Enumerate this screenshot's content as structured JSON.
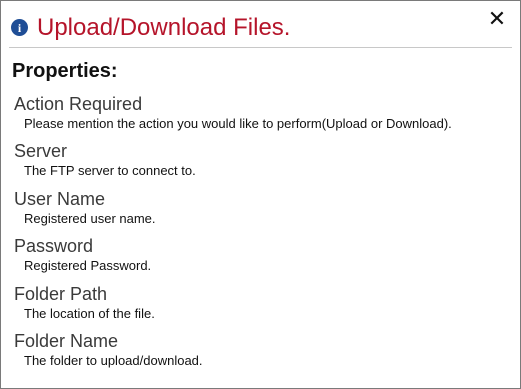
{
  "dialog": {
    "title": "Upload/Download Files.",
    "icon": "info-icon",
    "close_symbol": "✕",
    "title_color": "#b5142a",
    "icon_color": "#1f4e96"
  },
  "properties": {
    "heading": "Properties:",
    "items": [
      {
        "name": "Action Required",
        "description": "Please mention the action you would like to perform(Upload or Download)."
      },
      {
        "name": "Server",
        "description": "The FTP server to connect to."
      },
      {
        "name": "User Name",
        "description": "Registered user name."
      },
      {
        "name": "Password",
        "description": "Registered Password."
      },
      {
        "name": "Folder Path",
        "description": "The location of the file."
      },
      {
        "name": "Folder Name",
        "description": "The folder to upload/download."
      }
    ]
  }
}
